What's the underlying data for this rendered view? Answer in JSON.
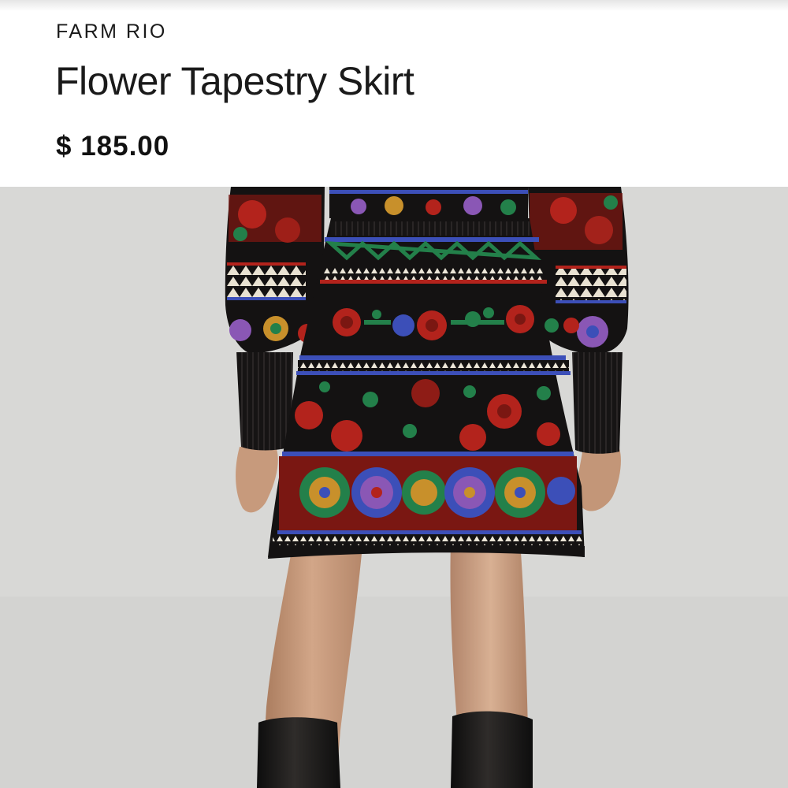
{
  "product": {
    "brand": "FARM RIO",
    "title": "Flower Tapestry Skirt",
    "price": "$ 185.00"
  },
  "image": {
    "icon": "product-photo"
  },
  "colors": {
    "background": "#d8d8d6",
    "knit_black": "#141212",
    "knit_red": "#b3231c",
    "knit_blue": "#3c4fb8",
    "knit_green": "#23804a",
    "knit_purple": "#8a57b5",
    "knit_yellow": "#c8902b",
    "skin": "#c79a7c"
  }
}
